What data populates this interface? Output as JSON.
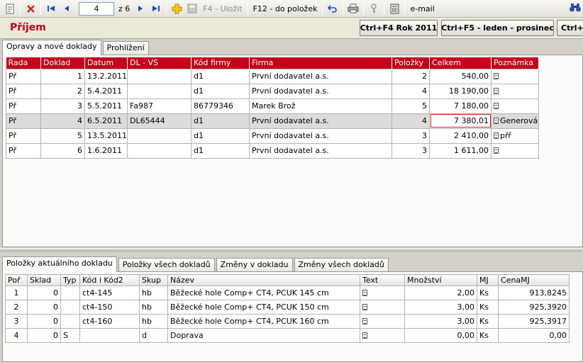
{
  "toolbar": {
    "page_value": "4",
    "page_total": "z 6",
    "save_label": "F4 - Uložit",
    "items_label": "F12 - do položek",
    "email_label": "e-mail"
  },
  "header": {
    "title": "Příjem",
    "btn_year": "Ctrl+F4 Rok 2011",
    "btn_months": "Ctrl+F5 - leden - prosinec",
    "btn_cut": "Ctrl+F"
  },
  "top_tabs": [
    "Opravy a nové doklady",
    "Prohlížení"
  ],
  "docs": {
    "columns": [
      "Řada",
      "Doklad",
      "Datum",
      "DL - VS",
      "Kód firmy",
      "Firma",
      "Položky",
      "Celkem",
      "Poznámka"
    ],
    "rows": [
      {
        "rada": "Př",
        "doklad": "1",
        "datum": "13.2.2011",
        "dlvs": "",
        "kod": "d1",
        "firma": "První dodavatel a.s.",
        "polozky": "2",
        "celkem": "540,00",
        "pozn": ""
      },
      {
        "rada": "Př",
        "doklad": "2",
        "datum": "5.4.2011",
        "dlvs": "",
        "kod": "d1",
        "firma": "První dodavatel a.s.",
        "polozky": "4",
        "celkem": "18 190,00",
        "pozn": ""
      },
      {
        "rada": "Př",
        "doklad": "3",
        "datum": "5.5.2011",
        "dlvs": "Fa987",
        "kod": "86779346",
        "firma": "Marek Brož",
        "polozky": "5",
        "celkem": "7 180,00",
        "pozn": ""
      },
      {
        "rada": "Př",
        "doklad": "4",
        "datum": "6.5.2011",
        "dlvs": "DL65444",
        "kod": "d1",
        "firma": "První dodavatel a.s.",
        "polozky": "4",
        "celkem": "7 380,01",
        "pozn": "Generován..."
      },
      {
        "rada": "Př",
        "doklad": "5",
        "datum": "13.5.2011",
        "dlvs": "",
        "kod": "d1",
        "firma": "První dodavatel a.s.",
        "polozky": "3",
        "celkem": "2 410,00",
        "pozn": "přř"
      },
      {
        "rada": "Př",
        "doklad": "6",
        "datum": "1.6.2011",
        "dlvs": "",
        "kod": "d1",
        "firma": "První dodavatel a.s.",
        "polozky": "3",
        "celkem": "1 611,00",
        "pozn": ""
      }
    ]
  },
  "bottom_tabs": [
    "Položky aktuálního dokladu",
    "Položky všech dokladů",
    "Změny v dokladu",
    "Změny všech dokladů"
  ],
  "items": {
    "columns": [
      "Poř",
      "Sklad",
      "Typ",
      "Kód i Kód2",
      "Skup",
      "Název",
      "Text",
      "Množství",
      "MJ",
      "CenaMJ"
    ],
    "rows": [
      {
        "por": "1",
        "sklad": "0",
        "typ": "",
        "kod": "ct4-145",
        "skup": "hb",
        "nazev": "Běžecké hole Comp+ CT4, PCUK 145 cm",
        "mnozstvi": "2,00",
        "mj": "Ks",
        "cena": "913,8245"
      },
      {
        "por": "2",
        "sklad": "0",
        "typ": "",
        "kod": "ct4-150",
        "skup": "hb",
        "nazev": "Běžecké hole Comp+ CT4, PCUK 150 cm",
        "mnozstvi": "3,00",
        "mj": "Ks",
        "cena": "925,3920"
      },
      {
        "por": "3",
        "sklad": "0",
        "typ": "",
        "kod": "ct4-160",
        "skup": "hb",
        "nazev": "Běžecké hole Comp+ CT4, PCUK 160 cm",
        "mnozstvi": "3,00",
        "mj": "Ks",
        "cena": "925,3917"
      },
      {
        "por": "4",
        "sklad": "0",
        "typ": "S",
        "kod": "",
        "skup": "d",
        "nazev": "Doprava",
        "mnozstvi": "0,00",
        "mj": "Ks",
        "cena": "0,00"
      }
    ]
  },
  "colors": {
    "accent": "#c4001a",
    "selected_row": "#dcdcdc",
    "focus_border": "#d31f2e"
  }
}
